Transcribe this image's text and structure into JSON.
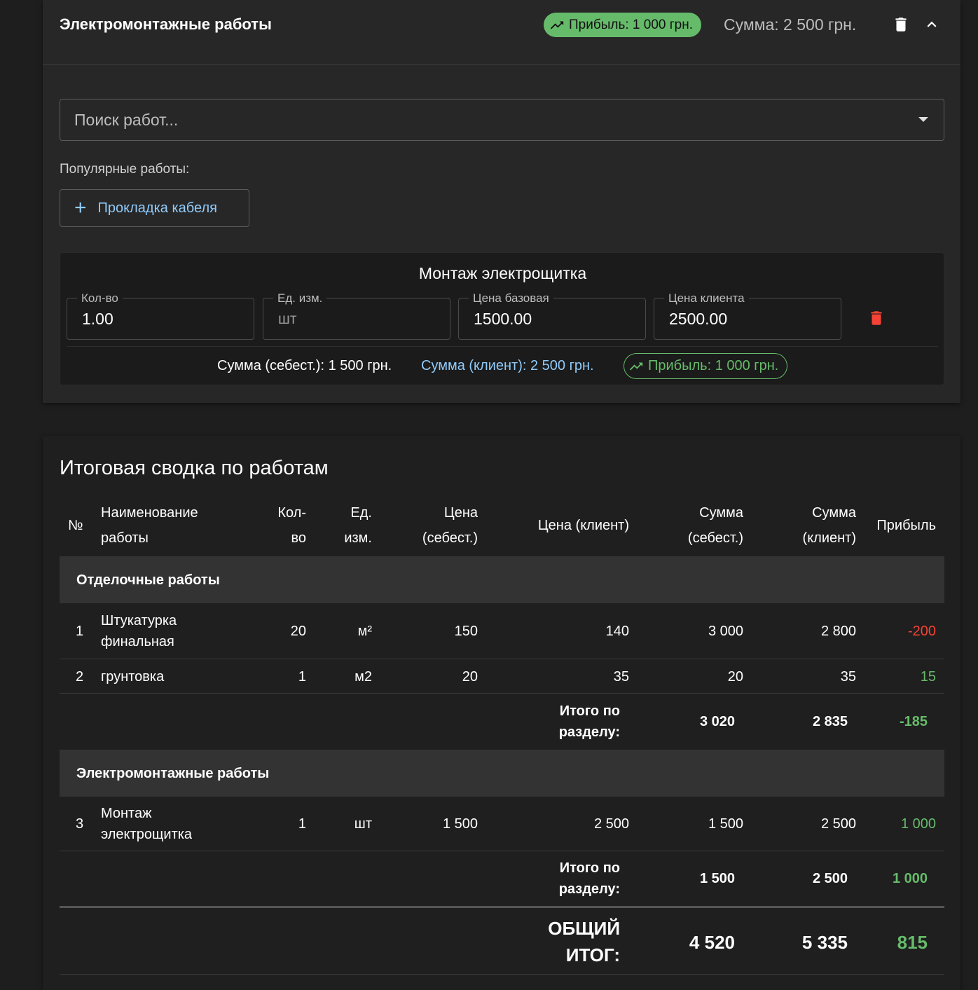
{
  "section": {
    "title": "Электромонтажные работы",
    "profit_chip": "Прибыль: 1 000 грн.",
    "sum": "Сумма: 2 500 грн.",
    "icons": [
      "trash-icon",
      "chevron-up-icon",
      "trending-up-icon"
    ]
  },
  "search": {
    "placeholder": "Поиск работ..."
  },
  "popular": {
    "label": "Популярные работы:",
    "button": "Прокладка кабеля"
  },
  "item": {
    "title": "Монтаж электрощитка",
    "fields": {
      "qty": {
        "label": "Кол-во",
        "value": "1.00"
      },
      "unit": {
        "label": "Ед. изм.",
        "value": "шт"
      },
      "base_price": {
        "label": "Цена базовая",
        "value": "1500.00"
      },
      "client_price": {
        "label": "Цена клиента",
        "value": "2500.00"
      }
    },
    "sum_cost": "Сумма (себест.): 1 500 грн.",
    "sum_client": "Сумма (клиент): 2 500 грн.",
    "profit": "Прибыль: 1 000 грн."
  },
  "summary": {
    "title": "Итоговая сводка по работам",
    "headers": {
      "num": "№",
      "name_1": "Наименование",
      "name_2": "работы",
      "qty_1": "Кол-",
      "qty_2": "во",
      "unit_1": "Ед.",
      "unit_2": "изм.",
      "cost_1": "Цена",
      "cost_2": "(себест.)",
      "client": "Цена (клиент)",
      "sumcost_1": "Сумма",
      "sumcost_2": "(себест.)",
      "sumclient_1": "Сумма",
      "sumclient_2": "(клиент)",
      "profit": "Прибыль"
    },
    "groups": [
      {
        "name": "Отделочные работы",
        "rows": [
          {
            "num": "1",
            "name_1": "Штукатурка",
            "name_2": "финальная",
            "qty": "20",
            "unit": "м²",
            "cost": "150",
            "client": "140",
            "sum_cost": "3 000",
            "sum_client": "2 800",
            "profit": "-200"
          },
          {
            "num": "2",
            "name_1": "грунтовка",
            "name_2": "",
            "qty": "1",
            "unit": "м2",
            "cost": "20",
            "client": "35",
            "sum_cost": "20",
            "sum_client": "35",
            "profit": "15"
          }
        ],
        "subtotal": {
          "label_1": "Итого по",
          "label_2": "разделу:",
          "sum_cost": "3 020",
          "sum_client": "2 835",
          "profit": "-185"
        }
      },
      {
        "name": "Электромонтажные работы",
        "rows": [
          {
            "num": "3",
            "name_1": "Монтаж",
            "name_2": "электрощитка",
            "qty": "1",
            "unit": "шт",
            "cost": "1 500",
            "client": "2 500",
            "sum_cost": "1 500",
            "sum_client": "2 500",
            "profit": "1 000"
          }
        ],
        "subtotal": {
          "label_1": "Итого по",
          "label_2": "разделу:",
          "sum_cost": "1 500",
          "sum_client": "2 500",
          "profit": "1 000"
        }
      }
    ],
    "grand_total": {
      "label_1": "ОБЩИЙ",
      "label_2": "ИТОГ:",
      "sum_cost": "4 520",
      "sum_client": "5 335",
      "profit": "815"
    }
  },
  "colors": {
    "profit_positive": "#66bb6a",
    "profit_negative": "#f44336",
    "accent": "#90caf9",
    "delete": "#f44336"
  }
}
